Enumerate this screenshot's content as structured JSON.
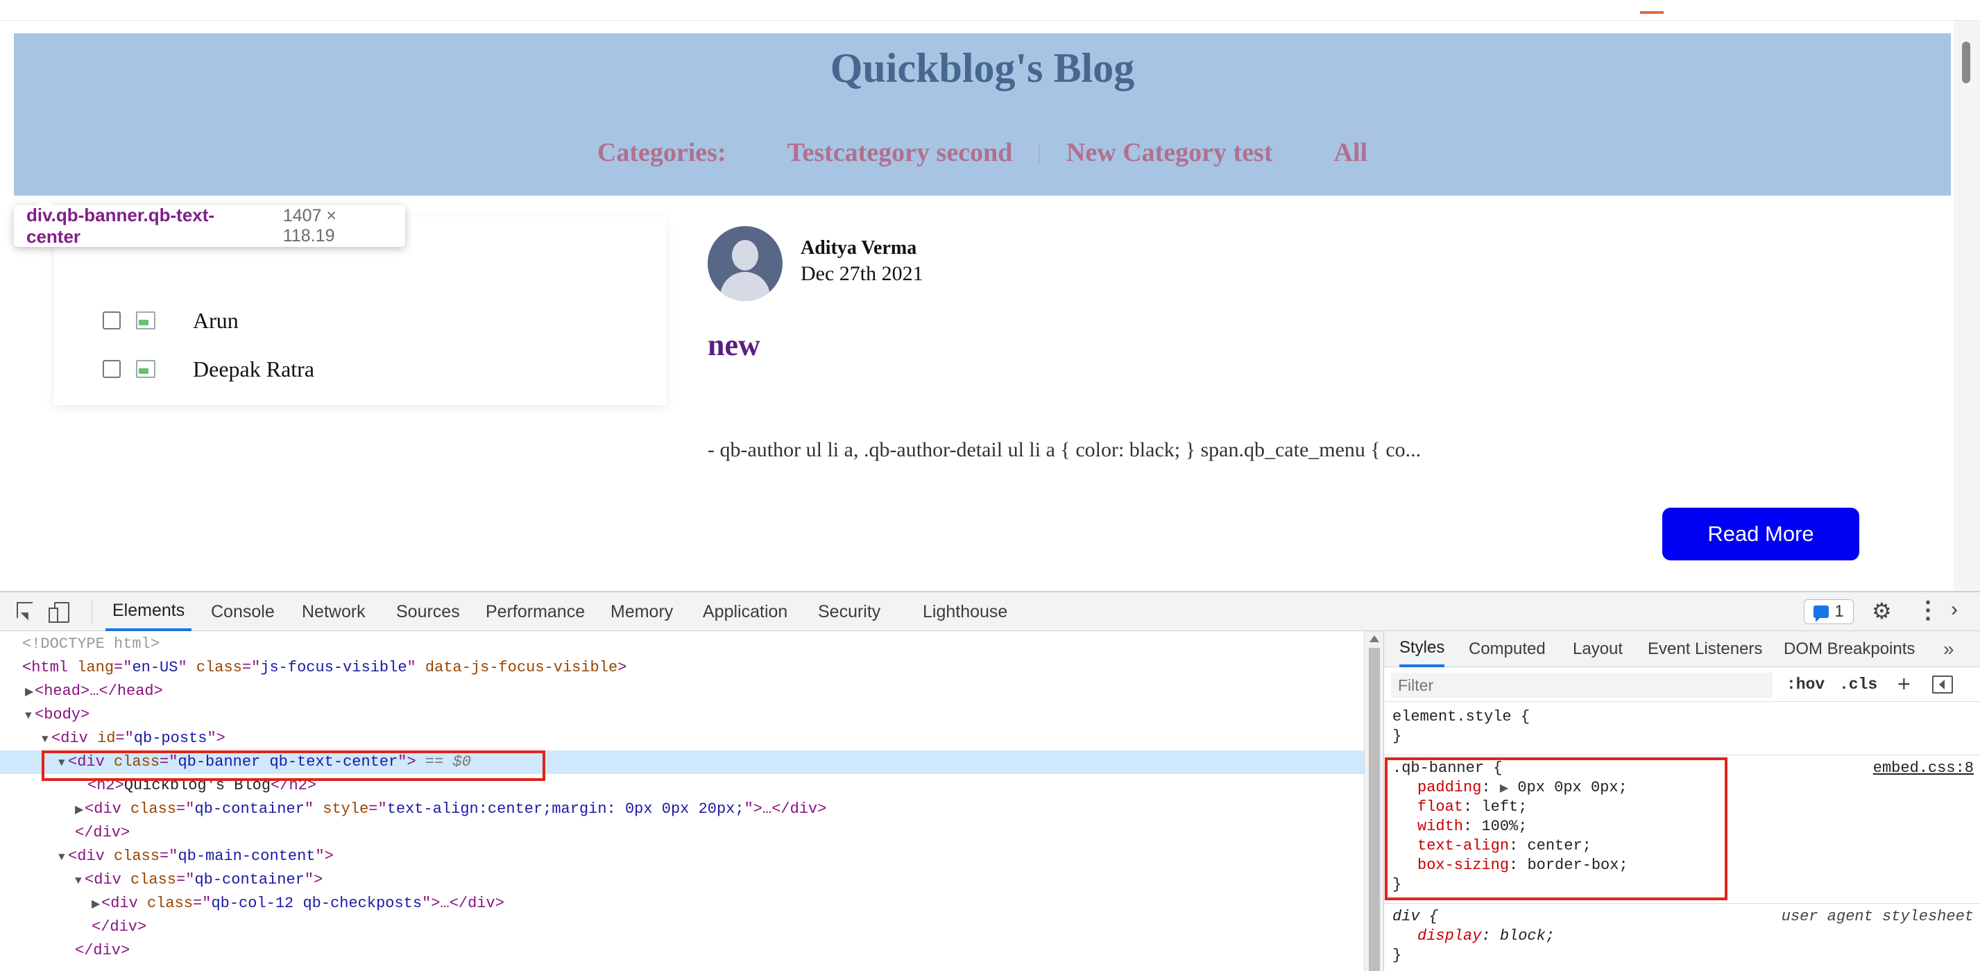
{
  "blog": {
    "title": "Quickblog's Blog",
    "categories_label": "Categories:",
    "categories": [
      "Testcategory second",
      "New Category test",
      "All"
    ],
    "category_separator": "|"
  },
  "tooltip": {
    "selector": "div.qb-banner.qb-text-center",
    "dimensions": "1407 × 118.19"
  },
  "authors": [
    "Arun",
    "Deepak Ratra"
  ],
  "post": {
    "author": "Aditya Verma",
    "date": "Dec 27th 2021",
    "title": "new",
    "excerpt": "- qb-author ul li a, .qb-author-detail ul li a { color: black; } span.qb_cate_menu { co...",
    "read_more": "Read More"
  },
  "devtools": {
    "tabs": [
      "Elements",
      "Console",
      "Network",
      "Sources",
      "Performance",
      "Memory",
      "Application",
      "Security",
      "Lighthouse"
    ],
    "active_tab": "Elements",
    "issues_count": "1",
    "dom": {
      "doctype": "<!DOCTYPE html>",
      "html_open": {
        "tag": "html",
        "attrs": [
          [
            "lang",
            "en-US"
          ],
          [
            "class",
            "js-focus-visible"
          ],
          [
            "data-js-focus-visible",
            ""
          ]
        ]
      },
      "head": "<head>…</head>",
      "body": "<body>",
      "qb_posts": "qb-posts",
      "banner_class": "qb-banner qb-text-center",
      "selected_marker": "== $0",
      "h2_text": "Quickblog's Blog",
      "container_class": "qb-container",
      "container_style": "text-align:center;margin: 0px 0px 20px;",
      "close_div": "</div>",
      "main_content_class": "qb-main-content",
      "checkposts_class": "qb-col-12 qb-checkposts"
    },
    "styles": {
      "tabs": [
        "Styles",
        "Computed",
        "Layout",
        "Event Listeners",
        "DOM Breakpoints"
      ],
      "active_tab": "Styles",
      "more": "»",
      "filter_placeholder": "Filter",
      "hov": ":hov",
      "cls": ".cls",
      "element_style": "element.style {",
      "close_brace": "}",
      "rule1": {
        "selector": ".qb-banner {",
        "source": "embed.css:8",
        "decls": [
          [
            "padding",
            "0px 0px 0px;"
          ],
          [
            "float",
            "left;"
          ],
          [
            "width",
            "100%;"
          ],
          [
            "text-align",
            "center;"
          ],
          [
            "box-sizing",
            "border-box;"
          ]
        ]
      },
      "rule2": {
        "selector": "div {",
        "source": "user agent stylesheet",
        "decls": [
          [
            "display",
            "block;"
          ]
        ]
      }
    }
  },
  "colors": {
    "banner_bg": "#a7c4e3",
    "banner_title": "#46678e",
    "category_link": "#b2708e",
    "read_more_bg": "#0000f2",
    "post_title": "#5a1e86",
    "annotation_red": "#e2231a",
    "selection_blue": "#cfe8fc"
  }
}
